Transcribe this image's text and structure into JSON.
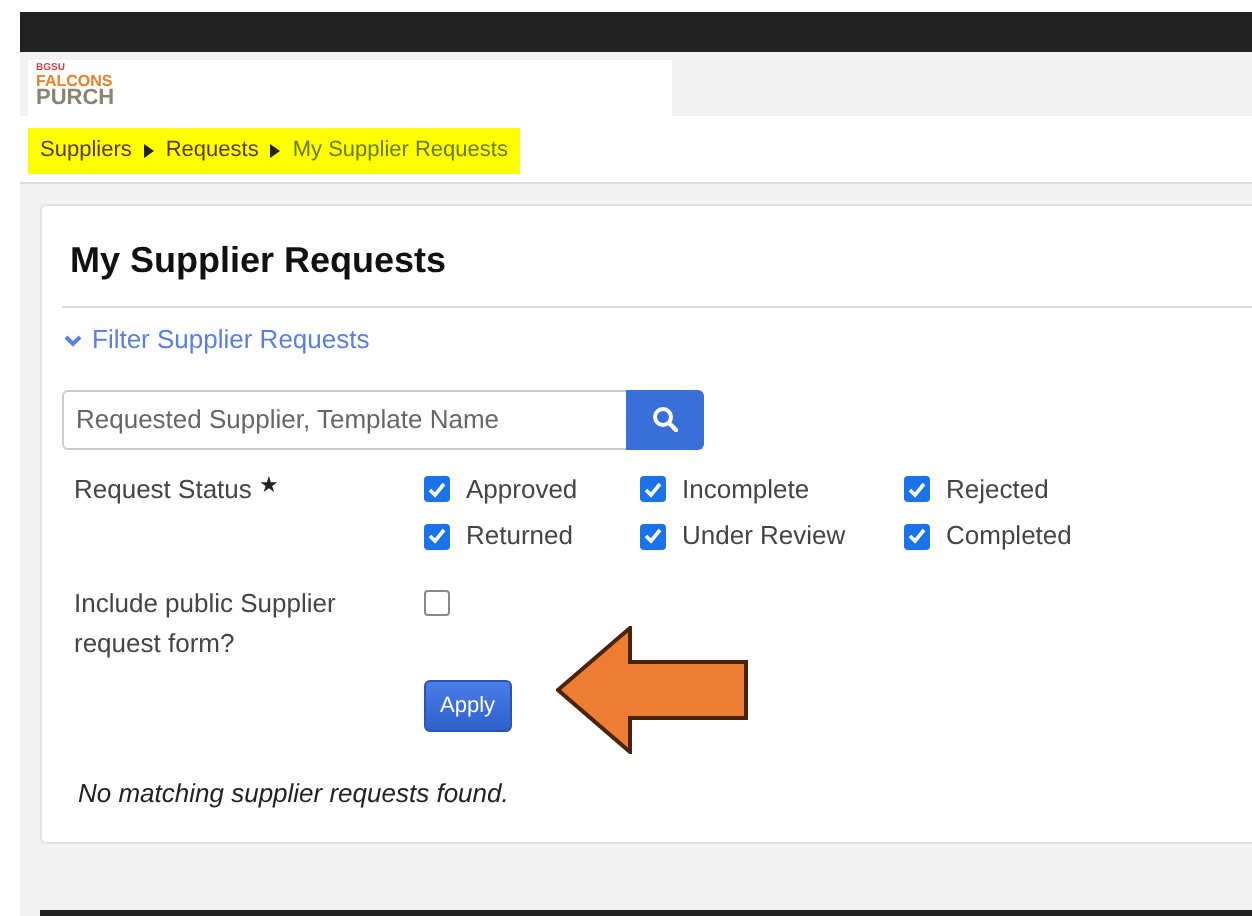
{
  "logo": {
    "lines": [
      "BGSU",
      "FALCONS",
      "PURCH"
    ]
  },
  "breadcrumb": [
    {
      "label": "Suppliers",
      "current": false
    },
    {
      "label": "Requests",
      "current": false
    },
    {
      "label": "My Supplier Requests",
      "current": true
    }
  ],
  "card": {
    "title": "My Supplier Requests",
    "filter_toggle": {
      "label": "Filter Supplier Requests",
      "expanded": true
    },
    "search": {
      "placeholder": "Requested Supplier, Template Name"
    },
    "request_status": {
      "label": "Request Status",
      "required_mark": "★",
      "options": [
        {
          "label": "Approved",
          "checked": true
        },
        {
          "label": "Incomplete",
          "checked": true
        },
        {
          "label": "Rejected",
          "checked": true
        },
        {
          "label": "Returned",
          "checked": true
        },
        {
          "label": "Under Review",
          "checked": true
        },
        {
          "label": "Completed",
          "checked": true
        }
      ]
    },
    "include_public": {
      "label": "Include public Supplier request form?",
      "checked": false
    },
    "apply_button": "Apply",
    "empty_message": "No matching supplier requests found."
  }
}
